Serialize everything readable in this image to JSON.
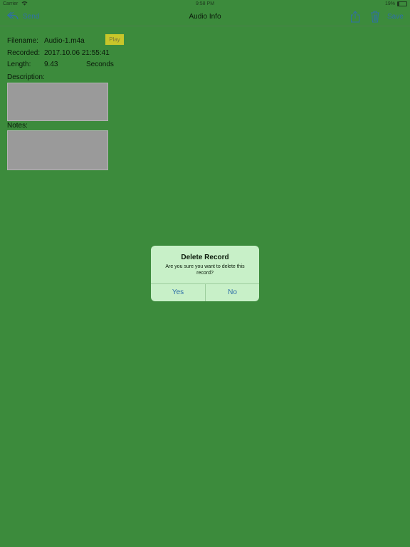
{
  "status_bar": {
    "carrier": "Carrier",
    "time": "9:58 PM",
    "battery": "19%",
    "battery_level": 0.19
  },
  "nav": {
    "send_label": "Send",
    "title": "Audio Info",
    "save_label": "Save",
    "icons": [
      "reply-arrow-icon",
      "share-icon",
      "trash-icon"
    ]
  },
  "info": {
    "filename_label": "Filename:",
    "filename_value": "Audio-1.m4a",
    "play_label": "Play",
    "recorded_label": "Recorded:",
    "recorded_value": "2017.10.06 21:55:41",
    "length_label": "Length:",
    "length_value": "9.43",
    "length_unit": "Seconds",
    "description_label": "Description:",
    "description_value": "",
    "notes_label": "Notes:",
    "notes_value": ""
  },
  "alert": {
    "title": "Delete Record",
    "message": "Are you sure you want to delete this record?",
    "yes_label": "Yes",
    "no_label": "No"
  },
  "colors": {
    "background": "#3c8b3c",
    "accent": "#2f6fa8",
    "play_button": "#c8c62a",
    "alert_background": "#c8f0c8"
  }
}
